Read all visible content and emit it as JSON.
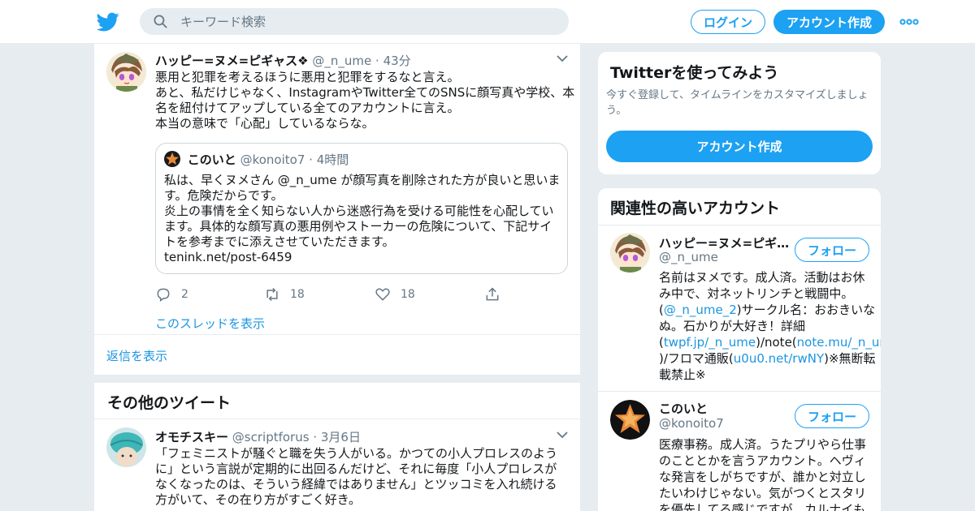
{
  "header": {
    "search_placeholder": "キーワード検索",
    "login_label": "ログイン",
    "signup_label": "アカウント作成"
  },
  "tweet": {
    "name": "ハッピー=ヌメ=ピギャス❖",
    "handle": "@_n_ume",
    "time": "43分",
    "text_lines": [
      "悪用と犯罪を考えるほうに悪用と犯罪をするなと言え。",
      "あと、私だけじゃなく、InstagramやTwitter全てのSNSに顔写真や学校、本",
      "名を紐付けてアップしている全てのアカウントに言え。",
      "本当の意味で「心配」しているならな。"
    ],
    "quote": {
      "name": "このいと",
      "handle": "@konoito7",
      "time": "4時間",
      "text_lines": [
        "私は、早くヌメさん  @_n_ume が顔写真を削除された方が良いと思いま",
        "す。危険だからです。",
        "炎上の事情を全く知らない人から迷惑行為を受ける可能性を心配してい",
        "ます。具体的な顔写真の悪用例やストーカーの危険について、下記サイ",
        "トを参考までに添えさせていただきます。",
        "tenink.net/post-6459"
      ]
    },
    "replies": "2",
    "retweets": "18",
    "likes": "18",
    "thread_link": "このスレッドを表示"
  },
  "show_replies": "返信を表示",
  "other_tweets_title": "その他のツイート",
  "tweet2": {
    "name": "オモチスキー",
    "handle": "@scriptforus",
    "time": "3月6日",
    "text_lines": [
      "「フェミニストが騒ぐと職を失う人がいる。かつての小人プロレスのよう",
      "に」という言説が定期的に出回るんだけど、それに毎度「小人プロレスが",
      "なくなったのは、そういう経緯ではありません」とツッコミを入れ続ける",
      "方がいて、その在り方がすごく好き。"
    ]
  },
  "try_card": {
    "title": "Twitterを使ってみよう",
    "subtitle_lines": [
      "今すぐ登録して、タイムラインをカスタマイズしましょ",
      "う。"
    ],
    "button": "アカウント作成"
  },
  "related": {
    "title": "関連性の高いアカウント",
    "follow_label": "フォロー",
    "accounts": [
      {
        "name": "ハッピー=ヌメ=ピギ…",
        "handle": "@_n_ume",
        "bio": {
          "l1": "名前はヌメです。成人済。活動はお休",
          "l2": "み中で、対ネットリンチと戦闘中。",
          "l3a": "(",
          "l3link": "@_n_ume_2",
          "l3b": ")サークル名：おおきいな",
          "l4": "ぬ。石かりが大好き！詳細",
          "l5a": "(",
          "l5link1": "twpf.jp/_n_ume",
          "l5b": ")/note(",
          "l5link2": "note.mu/_n_ume",
          "l6a": ")/フロマ通販(",
          "l6link": "u0u0.net/rwNY",
          "l6b": ")※無断転",
          "l7": "載禁止※"
        }
      },
      {
        "name": "このいと",
        "handle": "@konoito7",
        "bio_lines": [
          "医療事務。成人済。うたプリやら仕事",
          "のこととかを言うアカウント。ヘヴィ",
          "な発言をしがちですが、誰かと対立し",
          "たいわけじゃない。気がつくとスタリ",
          "を優先してる感じですが、カルナイも"
        ]
      }
    ]
  },
  "colors": {
    "accent": "#1da1f2",
    "link": "#1b95e0",
    "muted": "#657786"
  }
}
